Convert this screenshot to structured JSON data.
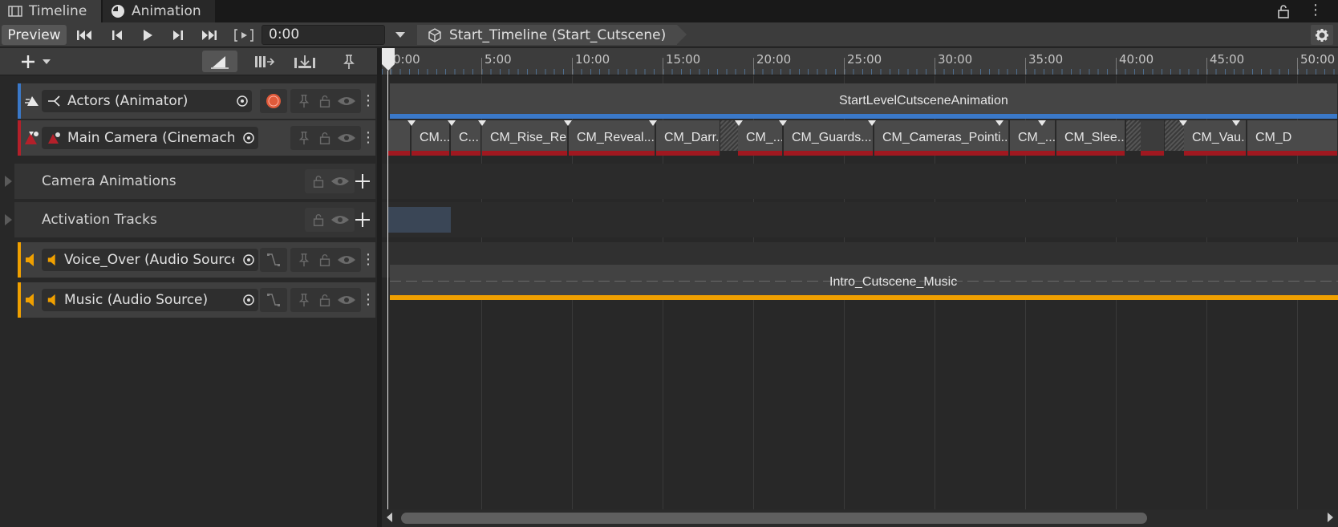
{
  "tabs": [
    {
      "label": "Timeline",
      "icon": "film-icon",
      "active": true
    },
    {
      "label": "Animation",
      "icon": "clock-icon",
      "active": false
    }
  ],
  "toolbar": {
    "preview_label": "Preview",
    "time_value": "0:00",
    "breadcrumb": "Start_Timeline (Start_Cutscene)"
  },
  "ruler": {
    "labels": [
      "0:00",
      "5:00",
      "10:00",
      "15:00",
      "20:00",
      "25:00",
      "30:00",
      "35:00",
      "40:00",
      "45:00",
      "50:00"
    ]
  },
  "tracks": [
    {
      "name": "Actors (Animator)",
      "color": "#3a78c8",
      "kind": "animator"
    },
    {
      "name": "Main Camera (Cinemachine",
      "color": "#b4202a",
      "kind": "cinemachine"
    },
    {
      "name": "Camera Animations",
      "kind": "group"
    },
    {
      "name": "Activation Tracks",
      "kind": "group"
    },
    {
      "name": "Voice_Over (Audio Source)",
      "color": "#f0a000",
      "kind": "audio"
    },
    {
      "name": "Music (Audio Source)",
      "color": "#f0a000",
      "kind": "audio"
    }
  ],
  "clips": {
    "actors": "StartLevelCutsceneAnimation",
    "camera": [
      "CM...",
      "C...",
      "CM_Rise_Re...",
      "CM_Reveal...",
      "CM_Darr...",
      "CM_...",
      "CM_Guards...",
      "CM_Cameras_Pointi...",
      "CM_...",
      "CM_Slee...",
      "CM_Vau...",
      "CM_D"
    ],
    "music": "Intro_Cutscene_Music"
  },
  "colors": {
    "animator": "#3a78c8",
    "cinemachine": "#b4202a",
    "audio": "#f0a000",
    "background": "#282828",
    "panel": "#3c3c3c"
  }
}
